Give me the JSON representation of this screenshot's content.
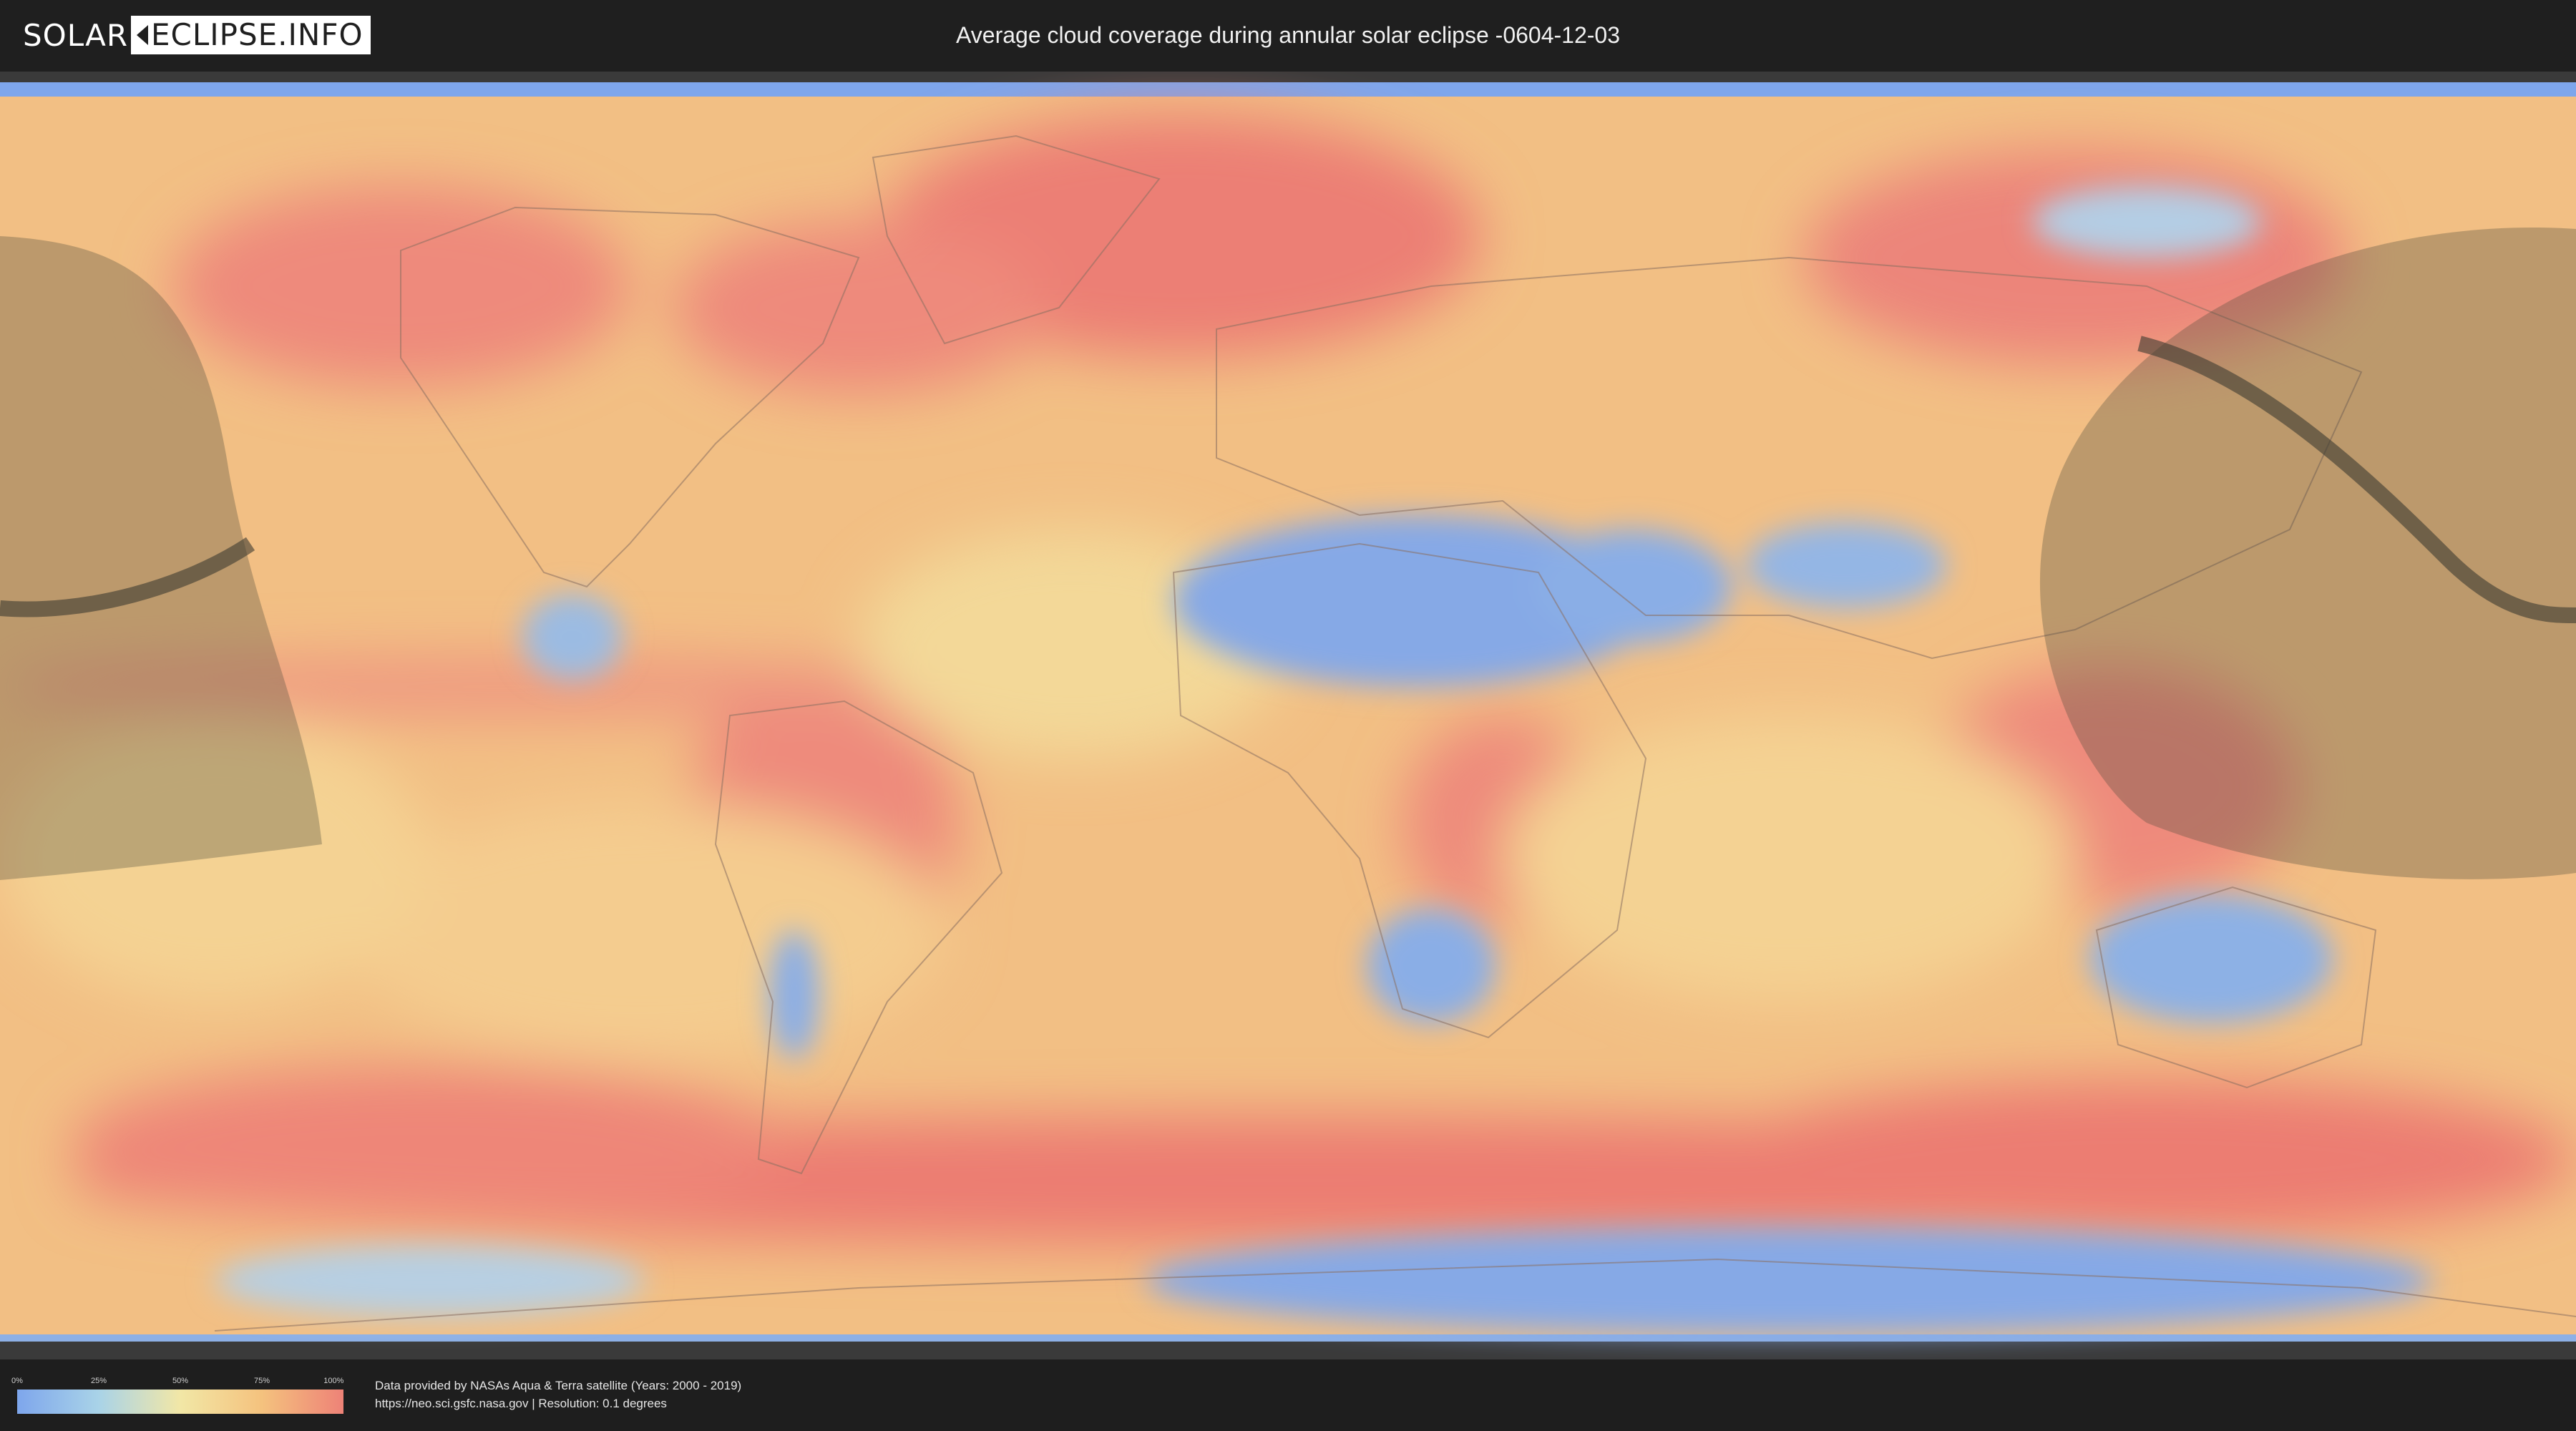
{
  "header": {
    "logo_left": "SOLAR",
    "logo_right": "ECLIPSE.INFO",
    "title": "Average cloud coverage during annular solar eclipse -0604-12-03"
  },
  "legend": {
    "ticks": [
      "0%",
      "25%",
      "50%",
      "75%",
      "100%"
    ],
    "gradient_colors": [
      "#7ea6ec",
      "#a9d3e8",
      "#f2e7a6",
      "#f4c27e",
      "#ee8277"
    ]
  },
  "credits": {
    "line1": "Data provided by NASAs Aqua & Terra satellite (Years: 2000 - 2019)",
    "line2": "https://neo.sci.gsfc.nasa.gov | Resolution: 0.1 degrees"
  },
  "colors": {
    "low_cloud": "#7ea6ec",
    "mid_cloud": "#f2d99a",
    "high_cloud": "#ee8277",
    "shadow_overlay": "#4a4a3a",
    "central_path": "#3c3a30"
  }
}
